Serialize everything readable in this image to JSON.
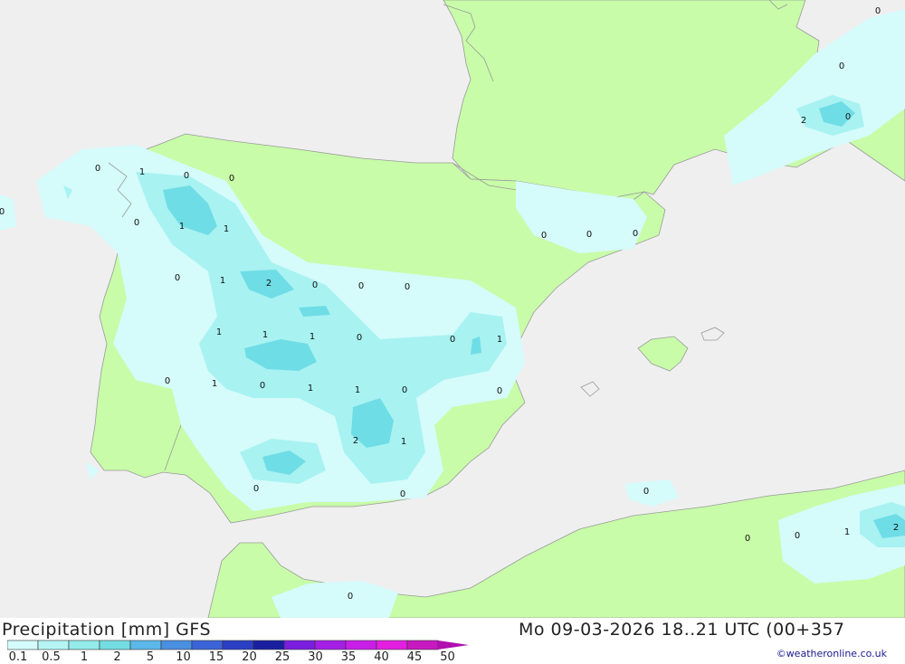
{
  "header": {
    "title_left": "Precipitation [mm] GFS",
    "title_right": "Mo 09-03-2026 18..21 UTC (00+357"
  },
  "legend": {
    "labels": [
      "0.1",
      "0.5",
      "1",
      "2",
      "5",
      "10",
      "15",
      "20",
      "25",
      "30",
      "35",
      "40",
      "45",
      "50"
    ],
    "colors": [
      "#d5fbfb",
      "#b6f4f4",
      "#95eaea",
      "#74dde2",
      "#5bb8e8",
      "#4a8fe0",
      "#3c64d8",
      "#2b3fc4",
      "#1a1fa0",
      "#7a1ee0",
      "#a51ee6",
      "#c81ee8",
      "#e41ee0",
      "#c818c0"
    ]
  },
  "credit": "©weatheronline.co.uk",
  "colors": {
    "sea": "#efefef",
    "land": "#c8fca8",
    "rain_light": "#d5fbfb",
    "rain_medium": "#a8f2f2",
    "rain_heavy": "#6fdde6"
  },
  "map_values": [
    {
      "text": "0"
    },
    {
      "text": "1"
    },
    {
      "text": "0"
    },
    {
      "text": "0"
    },
    {
      "text": "0"
    },
    {
      "text": "0"
    },
    {
      "text": "1"
    },
    {
      "text": "1"
    },
    {
      "text": "0"
    },
    {
      "text": "1"
    },
    {
      "text": "2"
    },
    {
      "text": "0"
    },
    {
      "text": "0"
    },
    {
      "text": "0"
    },
    {
      "text": "1"
    },
    {
      "text": "1"
    },
    {
      "text": "1"
    },
    {
      "text": "0"
    },
    {
      "text": "0"
    },
    {
      "text": "1"
    },
    {
      "text": "0"
    },
    {
      "text": "1"
    },
    {
      "text": "0"
    },
    {
      "text": "1"
    },
    {
      "text": "1"
    },
    {
      "text": "0"
    },
    {
      "text": "0"
    },
    {
      "text": "2"
    },
    {
      "text": "1"
    },
    {
      "text": "0"
    },
    {
      "text": "0"
    },
    {
      "text": "0"
    },
    {
      "text": "0"
    },
    {
      "text": "0"
    },
    {
      "text": "0"
    },
    {
      "text": "0"
    },
    {
      "text": "0"
    },
    {
      "text": "1"
    },
    {
      "text": "2"
    },
    {
      "text": "0"
    },
    {
      "text": "0"
    },
    {
      "text": "0"
    },
    {
      "text": "2"
    },
    {
      "text": "0"
    }
  ]
}
